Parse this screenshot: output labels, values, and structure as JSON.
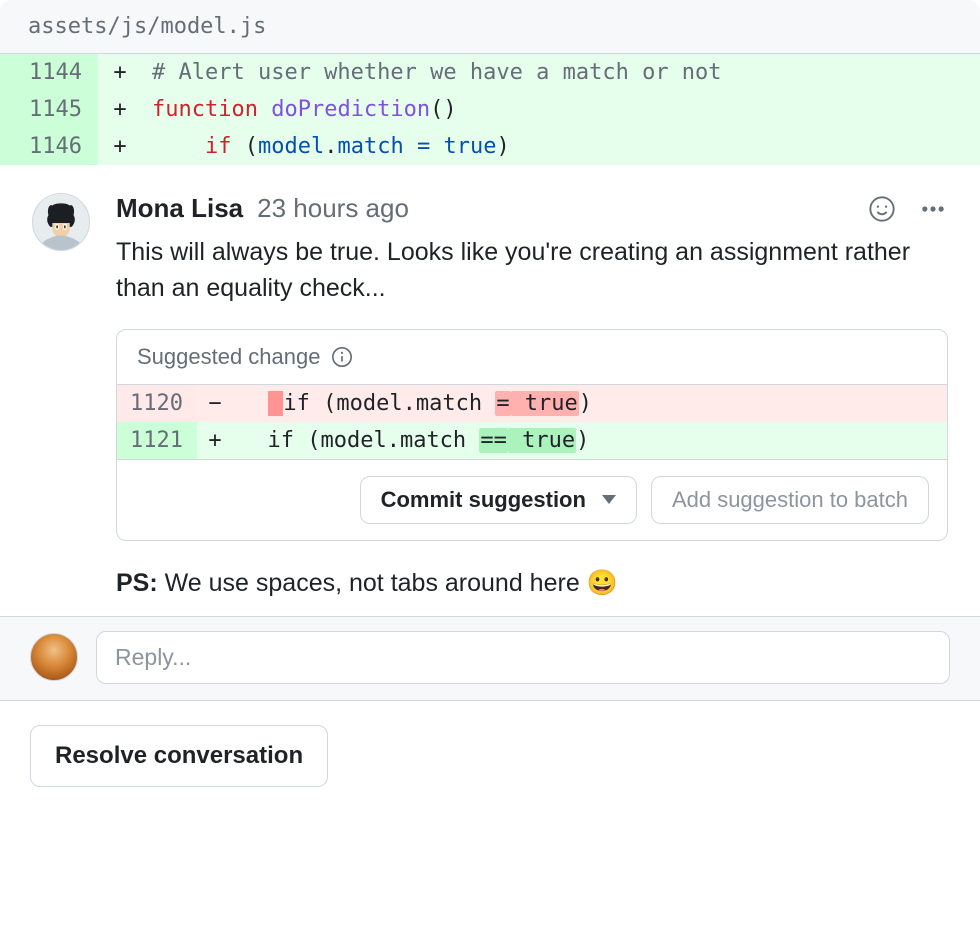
{
  "file_header": "assets/js/model.js",
  "diff": {
    "lines": [
      {
        "num": "1144",
        "mark": "+",
        "code_comment": "# Alert user whether we have a match or not"
      },
      {
        "num": "1145",
        "mark": "+",
        "code_func_kw": "function",
        "code_func_name": "doPrediction"
      },
      {
        "num": "1146",
        "mark": "+",
        "code_if_kw": "if",
        "code_obj": "model",
        "code_prop": "match",
        "code_op": "=",
        "code_val": "true"
      }
    ]
  },
  "comment": {
    "author": "Mona Lisa",
    "timestamp": "23 hours ago",
    "body": "This will always be true. Looks like you're creating an assignment rather than an equality check...",
    "ps_label": "PS:",
    "ps_body": "We use spaces, not tabs around here",
    "ps_emoji": "😀"
  },
  "suggestion": {
    "label": "Suggested change",
    "del": {
      "num": "1120",
      "mark": "−",
      "prefix": "if (model.match ",
      "op": "=",
      "val": " true",
      "suffix": ")"
    },
    "add": {
      "num": "1121",
      "mark": "+",
      "prefix": "if (model.match ",
      "op": "==",
      "val": " true",
      "suffix": ")"
    },
    "commit_label": "Commit suggestion",
    "batch_label": "Add suggestion to batch"
  },
  "reply": {
    "placeholder": "Reply..."
  },
  "resolve_label": "Resolve conversation"
}
